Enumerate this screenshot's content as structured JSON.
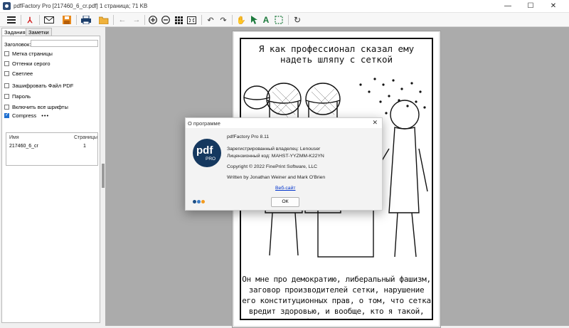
{
  "window": {
    "title": "pdfFactory Pro [217460_6_cr.pdf] 1 страница; 71 KB",
    "minimize": "—",
    "maximize": "☐",
    "close": "✕"
  },
  "toolbar": {
    "icons": [
      "menu-icon",
      "pdf-icon",
      "mail-icon",
      "save-icon",
      "print-icon",
      "open-icon",
      "back-icon",
      "forward-icon",
      "zoom-in-icon",
      "zoom-out-icon",
      "grid-icon",
      "fit-page-icon",
      "undo-icon",
      "redo-icon",
      "hand-icon",
      "pointer-icon",
      "text-select-icon",
      "area-select-icon",
      "refresh-icon"
    ]
  },
  "sidebar": {
    "tabs": [
      "Задания",
      "Заметки"
    ],
    "active_tab": "Задания",
    "title_label": "Заголовок:",
    "title_value": "",
    "checkboxes": [
      {
        "label": "Метка страницы",
        "checked": false
      },
      {
        "label": "Оттенки серого",
        "checked": false
      },
      {
        "label": "Светлее",
        "checked": false
      },
      {
        "label": "Зашифровать Файл PDF",
        "checked": false
      },
      {
        "label": "Пароль",
        "checked": false
      },
      {
        "label": "Включить все шрифты",
        "checked": false
      },
      {
        "label": "Compress",
        "checked": true
      }
    ],
    "compress_more": "•••",
    "list": {
      "headers": [
        "Имя",
        "Страницы"
      ],
      "rows": [
        [
          "217460_6_cr",
          "1"
        ]
      ]
    }
  },
  "document": {
    "caption_top": "Я как профессионал сказал ему надеть шляпу с сеткой",
    "caption_bottom": "Он мне про демократию, либеральный фашизм, заговор производителей сетки, нарушение его конституционных прав, о том, что сетка вредит здоровью, и вообще, кто я такой, чтобы ему указывать."
  },
  "about_dialog": {
    "title": "О программе",
    "close": "✕",
    "logo_text": "pdf",
    "logo_sub": "PRO",
    "product": "pdfFactory Pro 8.11",
    "owner": "Зарегистрированный владелец:  Lenouser",
    "license": "Лицензионный код:  MAHST-YYZMM-K22YN",
    "copyright": "Copyright © 2022 FinePrint Software, LLC",
    "authors": "Written by Jonathan Weiner and Mark O'Brien",
    "link": "Веб-сайт",
    "ok": "ОК",
    "dot_colors": [
      "#1c4f86",
      "#3b7bc4",
      "#f29a1f"
    ]
  }
}
